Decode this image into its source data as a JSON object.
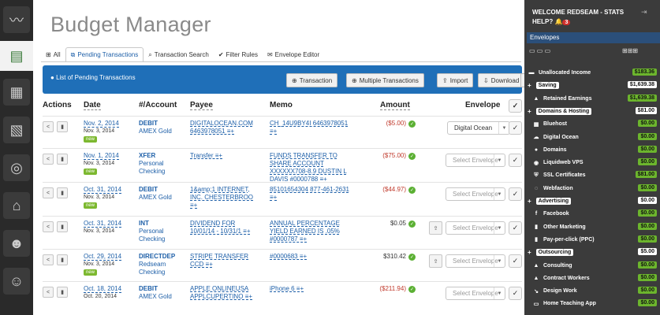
{
  "app": {
    "title": "Budget Manager"
  },
  "tabs": [
    {
      "label": "All"
    },
    {
      "label": "Pending Transactions"
    },
    {
      "label": "Transaction Search"
    },
    {
      "label": "Filter Rules"
    },
    {
      "label": "Envelope Editor"
    }
  ],
  "panel": {
    "title": "List of Pending Transactions",
    "buttons": {
      "transaction": "Transaction",
      "multiple": "Multiple Transactions",
      "import": "Import",
      "download": "Download"
    }
  },
  "columns": {
    "actions": "Actions",
    "date": "Date",
    "account": "#/Account",
    "payee": "Payee",
    "memo": "Memo",
    "amount": "Amount",
    "envelope": "Envelope"
  },
  "rows": [
    {
      "date": "Nov. 2, 2014",
      "sub": "Nov. 3, 2014",
      "new": "new",
      "acct1": "DEBIT",
      "acct2": "AMEX Gold",
      "acct3": "",
      "payee1": "DIGITALOCEAN.COM",
      "payee2": "6463978051 ≡+",
      "payee3": "",
      "memo1": "CH_14U9BY4I 6463978051",
      "memo2": "≡+",
      "memo3": "",
      "memo4": "",
      "amount": "($5.00)",
      "envelope": "Digital Ocean"
    },
    {
      "date": "Nov. 1, 2014",
      "sub": "Nov. 3, 2014",
      "new": "new",
      "acct1": "XFER",
      "acct2": "Personal",
      "acct3": "Checking",
      "payee1": "Transfer ≡+",
      "payee2": "",
      "payee3": "",
      "memo1": "FUNDS TRANSFER TO",
      "memo2": "SHARE ACCOUNT",
      "memo3": "XXXXXX708-8.9 DUSTIN L",
      "memo4": "DAVIS #0000788 ≡+",
      "amount": "($75.00)",
      "envelope": "Select Envelope"
    },
    {
      "date": "Oct. 31, 2014",
      "sub": "Nov. 3, 2014",
      "new": "new",
      "acct1": "DEBIT",
      "acct2": "AMEX Gold",
      "acct3": "",
      "payee1": "1&amp;1 INTERNET,",
      "payee2": "INC. CHESTERBROO",
      "payee3": "≡+",
      "memo1": "85101654304 877-461-2631",
      "memo2": "≡+",
      "memo3": "",
      "memo4": "",
      "amount": "($44.97)",
      "envelope": "Select Envelope"
    },
    {
      "date": "Oct. 31, 2014",
      "sub": "Nov. 3, 2014",
      "new": "",
      "acct1": "INT",
      "acct2": "Personal",
      "acct3": "Checking",
      "payee1": "DIVIDEND FOR",
      "payee2": "10/01/14 - 10/31/1 ≡+",
      "payee3": "",
      "memo1": "ANNUAL PERCENTAGE",
      "memo2": "YIELD EARNED IS .05%",
      "memo3": "#0000787 ≡+",
      "memo4": "",
      "amount": "$0.05",
      "envelope": "Select Envelope"
    },
    {
      "date": "Oct. 29, 2014",
      "sub": "Nov. 3, 2014",
      "new": "new",
      "acct1": "DIRECTDEP",
      "acct2": "Redseam",
      "acct3": "Checking",
      "payee1": "STRIPE TRANSFER",
      "payee2": "CCD ≡+",
      "payee3": "",
      "memo1": "#0000683 ≡+",
      "memo2": "",
      "memo3": "",
      "memo4": "",
      "amount": "$310.42",
      "envelope": "Select Envelope"
    },
    {
      "date": "Oct. 18, 2014",
      "sub": "Oct. 20, 2014",
      "new": "",
      "acct1": "DEBIT",
      "acct2": "AMEX Gold",
      "acct3": "",
      "payee1": "APPLE ONLINEUSA",
      "payee2": "APPLCUPERTINO ≡+",
      "payee3": "",
      "memo1": "iPhone 6 ≡+",
      "memo2": "",
      "memo3": "",
      "memo4": "",
      "amount": "($211.94)",
      "envelope": "Select Envelope"
    }
  ],
  "sidebar": {
    "welcome": "WELCOME REDSEAM - STATS",
    "help": "HELP?",
    "badge": "3",
    "envelopes_title": "Envelopes",
    "items": [
      {
        "label": "Unallocated Income",
        "value": "$183.36",
        "kind": "item"
      },
      {
        "label": "Saving",
        "value": "$1,639.38",
        "kind": "group"
      },
      {
        "label": "Retained Earnings",
        "value": "$1,639.38",
        "kind": "item"
      },
      {
        "label": "Domains & Hosting",
        "value": "$81.00",
        "kind": "group"
      },
      {
        "label": "Bluehost",
        "value": "$0.00",
        "kind": "item"
      },
      {
        "label": "Digital Ocean",
        "value": "$0.00",
        "kind": "item"
      },
      {
        "label": "Domains",
        "value": "$0.00",
        "kind": "item"
      },
      {
        "label": "Liquidweb VPS",
        "value": "$0.00",
        "kind": "item"
      },
      {
        "label": "SSL Certificates",
        "value": "$81.00",
        "kind": "item"
      },
      {
        "label": "Webfaction",
        "value": "$0.00",
        "kind": "item"
      },
      {
        "label": "Advertising",
        "value": "$0.00",
        "kind": "group"
      },
      {
        "label": "Facebook",
        "value": "$0.00",
        "kind": "item"
      },
      {
        "label": "Other Marketing",
        "value": "$0.00",
        "kind": "item"
      },
      {
        "label": "Pay-per-click (PPC)",
        "value": "$0.00",
        "kind": "item"
      },
      {
        "label": "Outsourcing",
        "value": "$5.00",
        "kind": "group"
      },
      {
        "label": "Consulting",
        "value": "$0.00",
        "kind": "item"
      },
      {
        "label": "Contract Workers",
        "value": "$0.00",
        "kind": "item"
      },
      {
        "label": "Design Work",
        "value": "$0.00",
        "kind": "item"
      },
      {
        "label": "Home Teaching App",
        "value": "$0.00",
        "kind": "item"
      }
    ]
  }
}
